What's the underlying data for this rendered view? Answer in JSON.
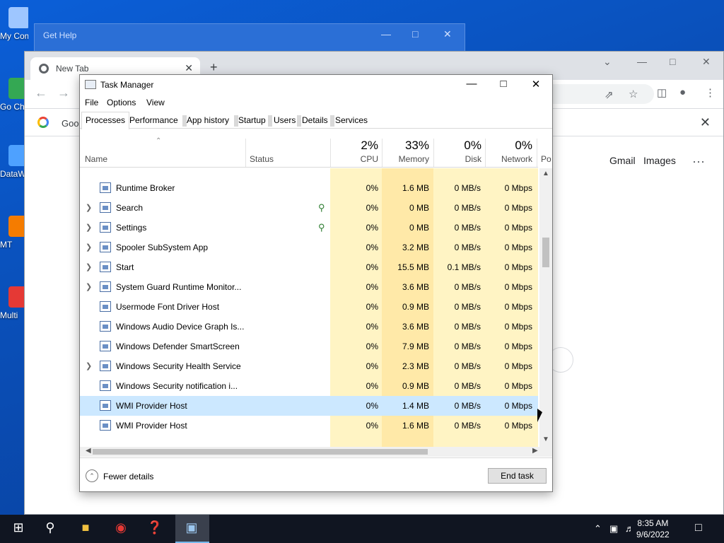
{
  "desktop": {
    "icons": [
      {
        "label": "My Com",
        "color": "#9ec6ff"
      },
      {
        "label": "Go Ch",
        "color": "#34a853"
      },
      {
        "label": "DataW",
        "color": "#4ea1ff"
      },
      {
        "label": "MT",
        "color": "#f57c00"
      },
      {
        "label": "Multi",
        "color": "#e53935"
      }
    ]
  },
  "get_help": {
    "title": "Get Help"
  },
  "chrome": {
    "tab_label": "New Tab",
    "infobar_text": "Goo",
    "links": {
      "gmail": "Gmail",
      "images": "Images"
    }
  },
  "task_manager": {
    "title": "Task Manager",
    "menu": [
      "File",
      "Options",
      "View"
    ],
    "tabs": [
      "Processes",
      "Performance",
      "App history",
      "Startup",
      "Users",
      "Details",
      "Services"
    ],
    "active_tab": "Processes",
    "headers": {
      "name": "Name",
      "status": "Status",
      "cpu": {
        "pct": "2%",
        "label": "CPU"
      },
      "memory": {
        "pct": "33%",
        "label": "Memory"
      },
      "disk": {
        "pct": "0%",
        "label": "Disk"
      },
      "network": {
        "pct": "0%",
        "label": "Network"
      },
      "power": "Po"
    },
    "rows": [
      {
        "name": "Runtime Broker",
        "expand": false,
        "leaf": false,
        "cpu": "0%",
        "memory": "1.6 MB",
        "disk": "0 MB/s",
        "network": "0 Mbps",
        "selected": false
      },
      {
        "name": "Search",
        "expand": true,
        "leaf": true,
        "cpu": "0%",
        "memory": "0 MB",
        "disk": "0 MB/s",
        "network": "0 Mbps",
        "selected": false
      },
      {
        "name": "Settings",
        "expand": true,
        "leaf": true,
        "cpu": "0%",
        "memory": "0 MB",
        "disk": "0 MB/s",
        "network": "0 Mbps",
        "selected": false
      },
      {
        "name": "Spooler SubSystem App",
        "expand": true,
        "leaf": false,
        "cpu": "0%",
        "memory": "3.2 MB",
        "disk": "0 MB/s",
        "network": "0 Mbps",
        "selected": false
      },
      {
        "name": "Start",
        "expand": true,
        "leaf": false,
        "cpu": "0%",
        "memory": "15.5 MB",
        "disk": "0.1 MB/s",
        "network": "0 Mbps",
        "selected": false
      },
      {
        "name": "System Guard Runtime Monitor...",
        "expand": true,
        "leaf": false,
        "cpu": "0%",
        "memory": "3.6 MB",
        "disk": "0 MB/s",
        "network": "0 Mbps",
        "selected": false
      },
      {
        "name": "Usermode Font Driver Host",
        "expand": false,
        "leaf": false,
        "cpu": "0%",
        "memory": "0.9 MB",
        "disk": "0 MB/s",
        "network": "0 Mbps",
        "selected": false
      },
      {
        "name": "Windows Audio Device Graph Is...",
        "expand": false,
        "leaf": false,
        "cpu": "0%",
        "memory": "3.6 MB",
        "disk": "0 MB/s",
        "network": "0 Mbps",
        "selected": false
      },
      {
        "name": "Windows Defender SmartScreen",
        "expand": false,
        "leaf": false,
        "cpu": "0%",
        "memory": "7.9 MB",
        "disk": "0 MB/s",
        "network": "0 Mbps",
        "selected": false
      },
      {
        "name": "Windows Security Health Service",
        "expand": true,
        "leaf": false,
        "cpu": "0%",
        "memory": "2.3 MB",
        "disk": "0 MB/s",
        "network": "0 Mbps",
        "selected": false
      },
      {
        "name": "Windows Security notification i...",
        "expand": false,
        "leaf": false,
        "cpu": "0%",
        "memory": "0.9 MB",
        "disk": "0 MB/s",
        "network": "0 Mbps",
        "selected": false
      },
      {
        "name": "WMI Provider Host",
        "expand": false,
        "leaf": false,
        "cpu": "0%",
        "memory": "1.4 MB",
        "disk": "0 MB/s",
        "network": "0 Mbps",
        "selected": true
      },
      {
        "name": "WMI Provider Host",
        "expand": false,
        "leaf": false,
        "cpu": "0%",
        "memory": "1.6 MB",
        "disk": "0 MB/s",
        "network": "0 Mbps",
        "selected": false
      }
    ],
    "footer": {
      "fewer_details": "Fewer details",
      "end_task": "End task"
    }
  },
  "taskbar": {
    "time": "8:35 AM",
    "date": "9/6/2022"
  },
  "colors": {
    "cpu_bg": "#fff4c4",
    "memory_bg": "#ffe9a8",
    "disk_bg": "#fff4c4",
    "network_bg": "#fff4c4",
    "selected": "#cce8ff"
  }
}
